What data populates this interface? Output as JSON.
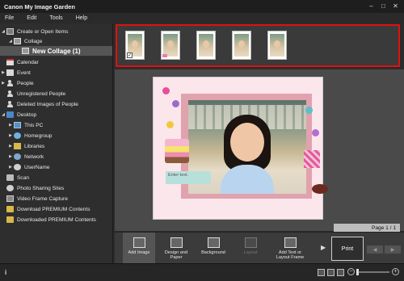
{
  "window": {
    "title": "Canon My Image Garden"
  },
  "menu": [
    "File",
    "Edit",
    "Tools",
    "Help"
  ],
  "tree": {
    "create_or_open": "Create or Open Items",
    "collage": "Collage",
    "new_collage": "New Collage (1)",
    "calendar": "Calendar",
    "event": "Event",
    "people": "People",
    "unregistered_people": "Unregistered People",
    "deleted_images": "Deleted Images of People",
    "desktop": "Desktop",
    "this_pc": "This PC",
    "homegroup": "Homegroup",
    "libraries": "Libraries",
    "network": "Network",
    "username": "UserName",
    "scan": "Scan",
    "photo_sharing": "Photo Sharing Sites",
    "video_capture": "Video Frame Capture",
    "download_premium": "Download PREMIUM Contents",
    "downloaded_premium": "Downloaded PREMIUM Contents"
  },
  "canvas": {
    "enter_text": "Enter text.",
    "page_indicator": "Page 1 / 1"
  },
  "toolbar": {
    "add_image": "Add Image",
    "design_paper": "Design and Paper",
    "background": "Background",
    "layout": "Layout",
    "add_text": "Add Text or Layout Frame",
    "print": "Print"
  },
  "status": {
    "info": "i"
  }
}
